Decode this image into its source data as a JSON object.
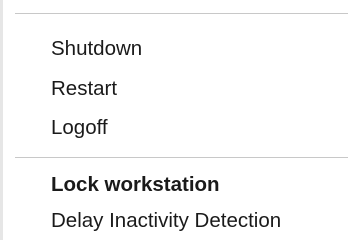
{
  "menu": {
    "items": [
      {
        "label": "Shutdown"
      },
      {
        "label": "Restart"
      },
      {
        "label": "Logoff"
      },
      {
        "label": "Lock workstation",
        "bold": true
      },
      {
        "label": "Delay Inactivity Detection"
      }
    ]
  }
}
